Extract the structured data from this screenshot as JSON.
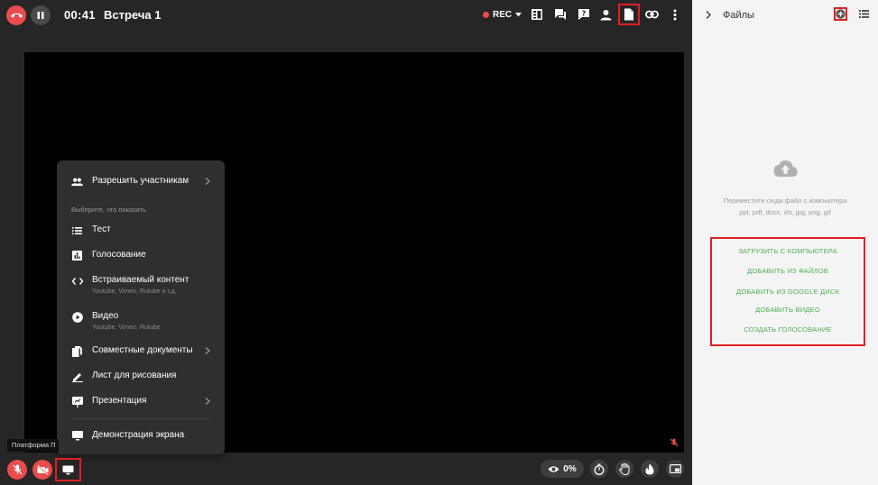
{
  "header": {
    "timer": "00:41",
    "title": "Встреча 1",
    "rec_label": "REC"
  },
  "menu": {
    "allow_participants": "Разрешить участникам",
    "section_label": "Выберите, что показать",
    "items": [
      {
        "label": "Тест",
        "sub": ""
      },
      {
        "label": "Голосование",
        "sub": ""
      },
      {
        "label": "Встраиваемый контент",
        "sub": "Youtube, Vimeo, Rutube и т.д."
      },
      {
        "label": "Видео",
        "sub": "Youtube, Vimeo, Rutube"
      },
      {
        "label": "Совместные документы",
        "sub": ""
      },
      {
        "label": "Лист для рисования",
        "sub": ""
      },
      {
        "label": "Презентация",
        "sub": ""
      }
    ],
    "screen_share": "Демонстрация экрана"
  },
  "tooltip": "Платформа П",
  "bottom_bar": {
    "viewers_percent": "0%"
  },
  "files_panel": {
    "title": "Файлы",
    "drop_hint_line1": "Переместите сюда файл с компьютера",
    "drop_hint_line2": "ppt, pdf, docx, xls, jpg, png, gif",
    "actions": [
      "ЗАГРУЗИТЬ С КОМПЬЮТЕРА",
      "ДОБАВИТЬ ИЗ ФАЙЛОВ",
      "ДОБАВИТЬ ИЗ GOOGLE ДИСК",
      "ДОБАВИТЬ ВИДЕО",
      "СОЗДАТЬ ГОЛОСОВАНИЕ"
    ]
  },
  "colors": {
    "accent_red": "#e84c4c",
    "highlight_red": "#e02020",
    "action_green": "#4caf50",
    "panel_bg": "#f4f4f4",
    "app_bg": "#262626"
  }
}
